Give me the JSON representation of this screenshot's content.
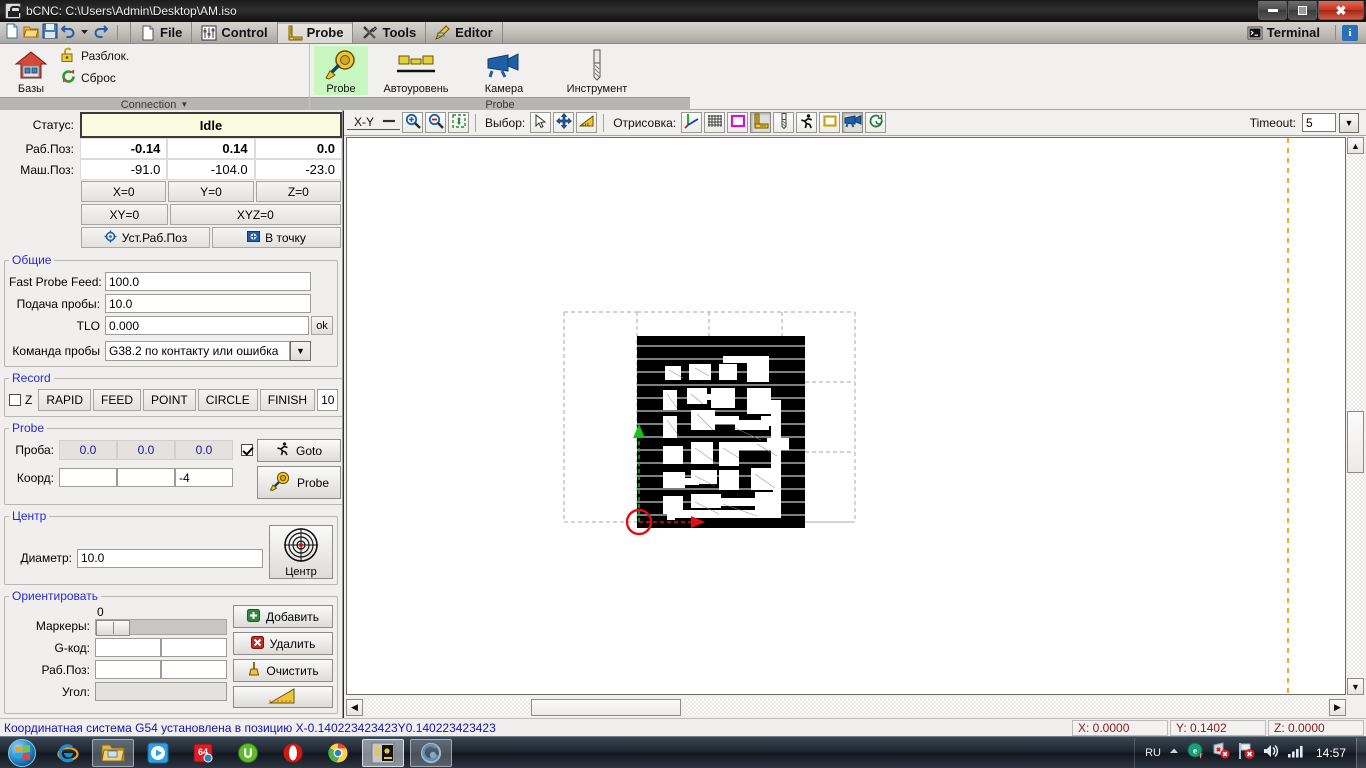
{
  "window": {
    "title": "bCNC: C:\\Users\\Admin\\Desktop\\AM.iso",
    "icon": "bcnc-app-icon",
    "minimize": "minimize-icon",
    "maximize": "restore-icon",
    "close": "✖"
  },
  "menu": {
    "tabs": [
      {
        "label": "File",
        "icon": "file-icon",
        "active": false
      },
      {
        "label": "Control",
        "icon": "sliders-icon",
        "active": false
      },
      {
        "label": "Probe",
        "icon": "ruler-icon",
        "active": true
      },
      {
        "label": "Tools",
        "icon": "tools-icon",
        "active": false
      },
      {
        "label": "Editor",
        "icon": "pencil-icon",
        "active": false
      }
    ],
    "terminal": "Terminal",
    "info": "i"
  },
  "ribbon": {
    "connection": {
      "group_label": "Connection",
      "home_label": "Базы",
      "unlock_label": "Разблок.",
      "reset_label": "Сброс"
    },
    "probe": {
      "group_label": "Probe",
      "items": [
        {
          "label": "Probe",
          "icon": "probe-icon",
          "selected": true
        },
        {
          "label": "Автоуровень",
          "icon": "autolevel-icon",
          "selected": false
        },
        {
          "label": "Камера",
          "icon": "camera-icon",
          "selected": false
        },
        {
          "label": "Инструмент",
          "icon": "endmill-icon",
          "selected": false
        }
      ]
    }
  },
  "dro": {
    "status_label": "Статус:",
    "status_value": "Idle",
    "wpos_label": "Раб.Поз:",
    "wpos": [
      "-0.14",
      "0.14",
      "0.0"
    ],
    "mpos_label": "Маш.Поз:",
    "mpos": [
      "-91.0",
      "-104.0",
      "-23.0"
    ],
    "zero_buttons": [
      "X=0",
      "Y=0",
      "Z=0"
    ],
    "zero_buttons2": [
      "XY=0",
      "XYZ=0"
    ],
    "set_wpos": "Уст.Раб.Поз",
    "goto_point": "В точку"
  },
  "general": {
    "legend": "Общие",
    "fast_probe_feed_label": "Fast Probe Feed:",
    "fast_probe_feed_value": "100.0",
    "probe_feed_label": "Подача пробы:",
    "probe_feed_value": "10.0",
    "tlo_label": "TLO",
    "tlo_value": "0.000",
    "tlo_ok": "ok",
    "probe_command_label": "Команда пробы",
    "probe_command_value": "G38.2 по контакту или ошибка"
  },
  "record": {
    "legend": "Record",
    "z_label": "Z",
    "z_checked": false,
    "buttons": [
      "RAPID",
      "FEED",
      "POINT",
      "CIRCLE",
      "FINISH"
    ],
    "value": "10"
  },
  "probe": {
    "legend": "Probe",
    "proba_label": "Проба:",
    "proba_values": [
      "0.0",
      "0.0",
      "0.0"
    ],
    "checkbox_checked": true,
    "goto_label": "Goto",
    "probe_label": "Probe",
    "coord_label": "Коорд:",
    "coord_values": [
      "",
      "",
      "-4"
    ]
  },
  "center": {
    "legend": "Центр",
    "diameter_label": "Диаметр:",
    "diameter_value": "10.0",
    "button_label": "Центр"
  },
  "orient": {
    "legend": "Ориентировать",
    "markers_label": "Маркеры:",
    "markers_value": "0",
    "gcode_label": "G-код:",
    "gcode_values": [
      "",
      ""
    ],
    "wpos_label": "Раб.Поз:",
    "wpos_values": [
      "",
      ""
    ],
    "angle_label": "Угол:",
    "add_label": "Добавить",
    "delete_label": "Удалить",
    "clear_label": "Очистить"
  },
  "canvas_toolbar": {
    "view_mode": "X-Y",
    "zoom_in": "zoom-in-icon",
    "zoom_out": "zoom-out-icon",
    "zoom_fit": "zoom-fit-icon",
    "select_label": "Выбор:",
    "select_tools": [
      "pointer-icon",
      "pan-icon",
      "ruler-select-icon"
    ],
    "draw_label": "Отрисовка:",
    "draw_tools": [
      "axes-icon",
      "grid-icon",
      "margin-icon",
      "ruler-icon",
      "endmill-icon",
      "runner-icon",
      "workarea-icon",
      "camera-icon",
      "probe-path-icon"
    ],
    "timeout_label": "Timeout:",
    "timeout_value": "5"
  },
  "statusbar": {
    "message": "Координатная система G54 установлена в позицию X-0.140223423423Y0.140223423423",
    "x": "X: 0.0000",
    "y": "Y: 0.1402",
    "z": "Z: 0.0000"
  },
  "taskbar": {
    "start": "start-orb",
    "items": [
      {
        "icon": "internet-explorer-icon",
        "state": "pinned"
      },
      {
        "icon": "file-explorer-icon",
        "state": "open"
      },
      {
        "icon": "media-player-icon",
        "state": "pinned"
      },
      {
        "icon": "movie-converter-icon",
        "state": "pinned"
      },
      {
        "icon": "utorrent-icon",
        "state": "pinned"
      },
      {
        "icon": "opera-icon",
        "state": "pinned"
      },
      {
        "icon": "chrome-icon",
        "state": "pinned"
      },
      {
        "icon": "bcnc-icon",
        "state": "active"
      },
      {
        "icon": "flashplayer-icon",
        "state": "open"
      }
    ],
    "language": "RU",
    "clock": "14:57",
    "tray": [
      "show-hidden-icon",
      "antivirus-icon",
      "network-error-icon",
      "volume-icon",
      "signal-icon"
    ]
  },
  "colors": {
    "status_bg": "#fbfbdf",
    "accent_blue": "#2a2ad0",
    "status_text": "#1414b4",
    "coord_text": "#8b1a1a",
    "selected_tool": "#c9f7c0",
    "toolpath_fill": "#000000",
    "origin_marker": "#e01010",
    "grid_dash": "#aaaaaa",
    "limit_line": "#e8a317"
  }
}
